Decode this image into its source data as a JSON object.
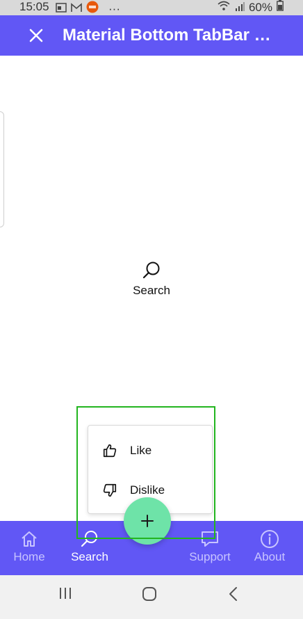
{
  "status_bar": {
    "time": "15:05",
    "battery": "60%",
    "more": "···",
    "notification_icons": [
      "calendar-icon",
      "gmail-icon",
      "app-badge-icon"
    ]
  },
  "app_bar": {
    "title": "Material Bottom TabBar Sa...",
    "close_icon": "close-icon"
  },
  "main": {
    "center_label": "Search",
    "center_icon": "search-icon"
  },
  "popup_menu": {
    "items": [
      {
        "label": "Like",
        "icon": "thumb-up-icon"
      },
      {
        "label": "Dislike",
        "icon": "thumb-down-icon"
      }
    ]
  },
  "bottom_nav": {
    "tabs": [
      {
        "label": "Home",
        "icon": "home-icon"
      },
      {
        "label": "Search",
        "icon": "search-icon"
      },
      {
        "label": "Support",
        "icon": "chat-icon"
      },
      {
        "label": "About",
        "icon": "info-icon"
      }
    ],
    "active": "Search",
    "fab_icon": "plus-icon"
  },
  "colors": {
    "primary": "#6157f5",
    "fab": "#6ee3a8",
    "highlight": "#22b51f",
    "inactive_tab": "#c8c4ff"
  }
}
